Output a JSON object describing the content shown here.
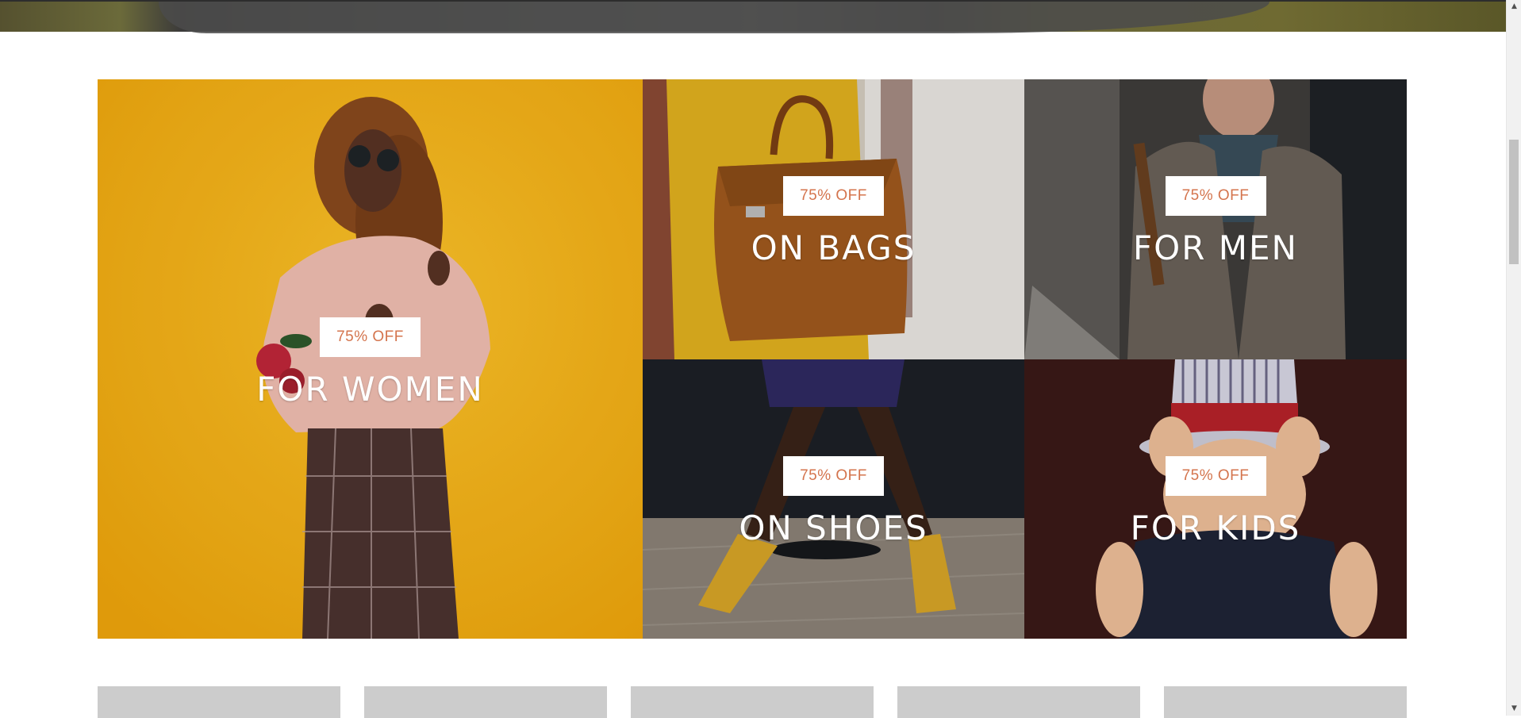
{
  "categories": {
    "women": {
      "badge": "75% OFF",
      "title": "FOR WOMEN"
    },
    "bags": {
      "badge": "75% OFF",
      "title": "ON BAGS"
    },
    "men": {
      "badge": "75% OFF",
      "title": "FOR MEN"
    },
    "shoes": {
      "badge": "75% OFF",
      "title": "ON SHOES"
    },
    "kids": {
      "badge": "75% OFF",
      "title": "FOR KIDS"
    }
  },
  "colors": {
    "badge_text": "#d4744d",
    "women_bg": "#f6b816",
    "bags_bg": "#c9b896",
    "men_bg": "#4a4542",
    "shoes_bg": "#2b2e33",
    "kids_bg": "#3a1a18",
    "placeholder_card": "#cccccc"
  },
  "icons": {
    "scroll_up": "up-arrow-icon",
    "scroll_down": "down-arrow-icon"
  }
}
